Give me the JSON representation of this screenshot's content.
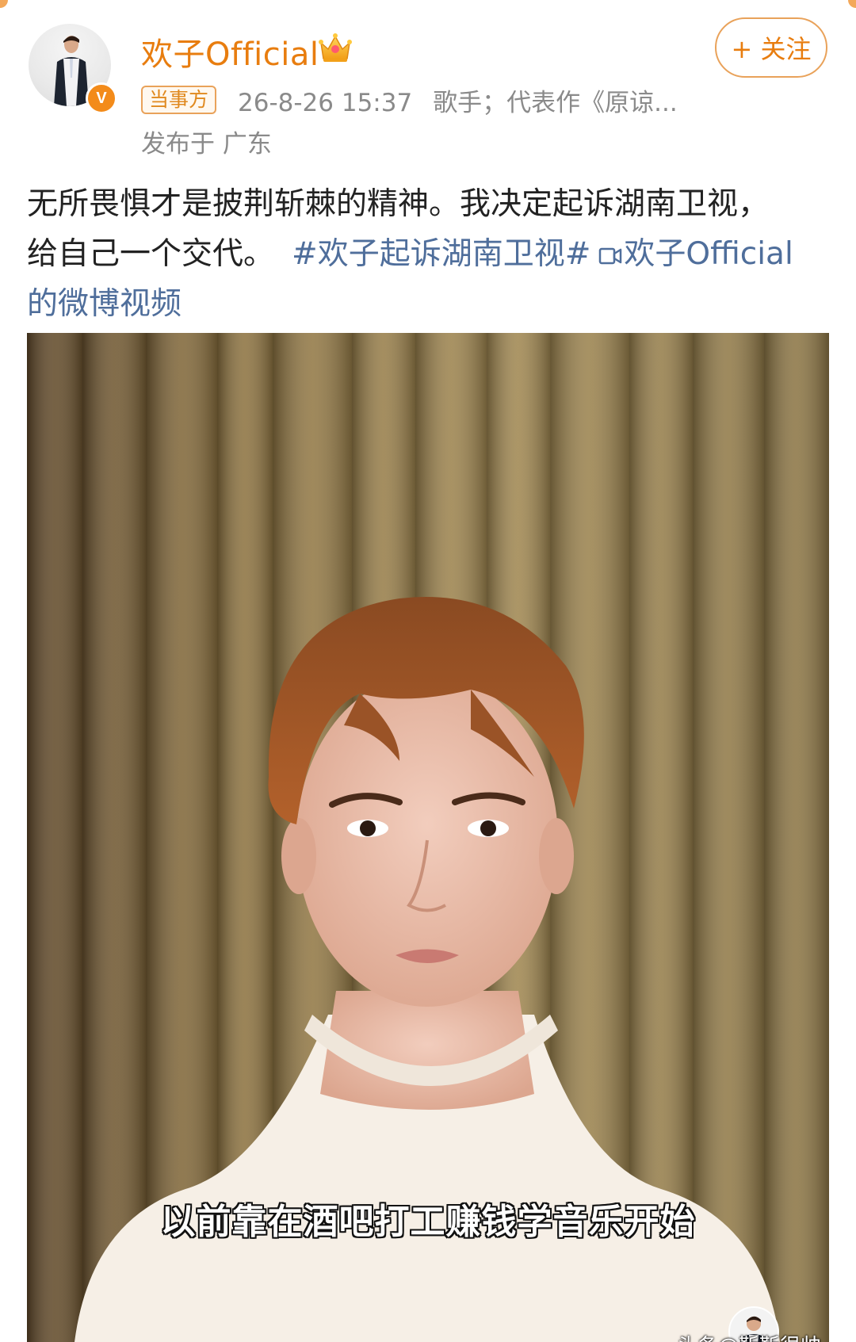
{
  "post": {
    "author": {
      "name": "欢子Official",
      "tag": "当事方"
    },
    "timestamp": "26-8-26 15:37",
    "author_desc": "歌手；代表作《原谅...",
    "location": "发布于 广东",
    "follow_label": "+ 关注",
    "text_line1": "无所畏惧才是披荆斩棘的精神。我决定起诉湖南卫视，",
    "text_line2_plain": "给自己一个交代。",
    "hashtag": "#欢子起诉湖南卫视#",
    "video_link_part1": "欢子Official",
    "video_link_part2": "的微博视频"
  },
  "video": {
    "subtitle": "以前靠在酒吧打工赚钱学音乐开始",
    "watermark": "头条@靳靳很帅"
  },
  "colors": {
    "accent_orange": "#e87d0f",
    "link_blue": "#4f6e9b",
    "meta_gray": "#8a8a8a",
    "curtain_base": "#8c7240"
  },
  "icons": {
    "verified": "verified-v-icon",
    "crown": "crown-icon",
    "video_link": "video-camera-icon"
  }
}
